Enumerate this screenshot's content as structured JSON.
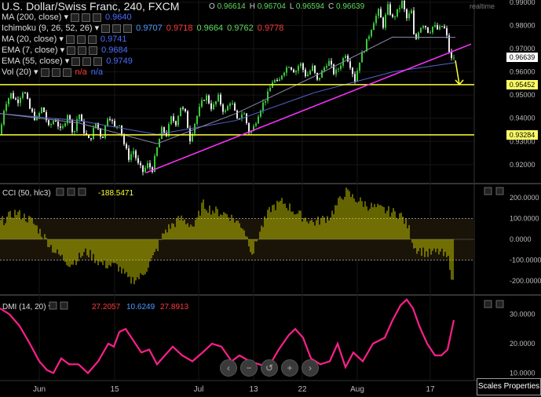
{
  "header": {
    "title": "U.S. Dollar/Swiss Franc, 240, FXCM",
    "ohlc": [
      {
        "k": "O",
        "v": "0.96614"
      },
      {
        "k": "H",
        "v": "0.96704"
      },
      {
        "k": "L",
        "v": "0.96594"
      },
      {
        "k": "C",
        "v": "0.96639"
      }
    ],
    "realtime": "realtime"
  },
  "indicators": [
    {
      "label": "MA (200, close)",
      "values": [
        {
          "v": "0.9640",
          "color": "#4a6cff"
        }
      ]
    },
    {
      "label": "Ichimoku (9, 26, 52, 26)",
      "values": [
        {
          "v": "0.9707",
          "color": "#4a9cff"
        },
        {
          "v": "0.9718",
          "color": "#ff3b3b"
        },
        {
          "v": "0.9664",
          "color": "#5fdc5f"
        },
        {
          "v": "0.9762",
          "color": "#5fdc5f"
        },
        {
          "v": "0.9778",
          "color": "#ff3b3b"
        }
      ]
    },
    {
      "label": "MA (20, close)",
      "values": [
        {
          "v": "0.9741",
          "color": "#4a6cff"
        }
      ]
    },
    {
      "label": "EMA (7, close)",
      "values": [
        {
          "v": "0.9684",
          "color": "#4a6cff"
        }
      ]
    },
    {
      "label": "EMA (55, close)",
      "values": [
        {
          "v": "0.9749",
          "color": "#4a6cff"
        }
      ]
    },
    {
      "label": "Vol (20)",
      "values": [
        {
          "v": "n/a",
          "color": "#ff3b3b"
        },
        {
          "v": "n/a",
          "color": "#4a6cff"
        }
      ]
    }
  ],
  "price_boxes": [
    {
      "v": "0.96639",
      "bg": "#ffffff"
    },
    {
      "v": "0.95452",
      "bg": "#ffff66"
    },
    {
      "v": "0.93284",
      "bg": "#ffff66"
    }
  ],
  "controls": {
    "scales_properties": "Scales Properties",
    "zoom_buttons": [
      "‹",
      "−",
      "↺",
      "+",
      "›"
    ]
  },
  "chart_data": [
    {
      "type": "candlestick",
      "title": "U.S. Dollar/Swiss Franc, 240, FXCM",
      "x_ticks": [
        "Jun",
        "15",
        "Jul",
        "13",
        "22",
        "Aug",
        "17"
      ],
      "y_ticks": [
        "0.99000",
        "0.98000",
        "0.97000",
        "0.96000",
        "0.95000",
        "0.94000",
        "0.93000",
        "0.92000"
      ],
      "ylim": [
        0.9125,
        0.991
      ],
      "close_path": [
        [
          0,
          0.933
        ],
        [
          6,
          0.946
        ],
        [
          14,
          0.9505
        ],
        [
          22,
          0.947
        ],
        [
          30,
          0.9525
        ],
        [
          38,
          0.944
        ],
        [
          46,
          0.939
        ],
        [
          54,
          0.945
        ],
        [
          62,
          0.936
        ],
        [
          70,
          0.94
        ],
        [
          78,
          0.934
        ],
        [
          86,
          0.942
        ],
        [
          94,
          0.933
        ],
        [
          100,
          0.943
        ],
        [
          106,
          0.935
        ],
        [
          114,
          0.93
        ],
        [
          122,
          0.938
        ],
        [
          130,
          0.931
        ],
        [
          138,
          0.942
        ],
        [
          146,
          0.936
        ],
        [
          152,
          0.938
        ],
        [
          158,
          0.929
        ],
        [
          164,
          0.923
        ],
        [
          170,
          0.926
        ],
        [
          176,
          0.92
        ],
        [
          182,
          0.917
        ],
        [
          188,
          0.92
        ],
        [
          194,
          0.918
        ],
        [
          200,
          0.927
        ],
        [
          206,
          0.935
        ],
        [
          212,
          0.933
        ],
        [
          218,
          0.94
        ],
        [
          224,
          0.938
        ],
        [
          230,
          0.945
        ],
        [
          236,
          0.942
        ],
        [
          242,
          0.931
        ],
        [
          248,
          0.938
        ],
        [
          256,
          0.946
        ],
        [
          262,
          0.95
        ],
        [
          270,
          0.944
        ],
        [
          278,
          0.949
        ],
        [
          286,
          0.942
        ],
        [
          294,
          0.948
        ],
        [
          302,
          0.939
        ],
        [
          310,
          0.943
        ],
        [
          318,
          0.933
        ],
        [
          324,
          0.937
        ],
        [
          330,
          0.943
        ],
        [
          336,
          0.947
        ],
        [
          342,
          0.951
        ],
        [
          348,
          0.957
        ],
        [
          354,
          0.9545
        ],
        [
          360,
          0.96
        ],
        [
          368,
          0.963
        ],
        [
          376,
          0.96
        ],
        [
          382,
          0.964
        ],
        [
          390,
          0.958
        ],
        [
          398,
          0.962
        ],
        [
          404,
          0.956
        ],
        [
          410,
          0.96
        ],
        [
          418,
          0.965
        ],
        [
          426,
          0.959
        ],
        [
          432,
          0.962
        ],
        [
          440,
          0.968
        ],
        [
          446,
          0.963
        ],
        [
          452,
          0.9565
        ],
        [
          458,
          0.965
        ],
        [
          464,
          0.97
        ],
        [
          470,
          0.976
        ],
        [
          476,
          0.982
        ],
        [
          482,
          0.986
        ],
        [
          488,
          0.98
        ],
        [
          494,
          0.988
        ],
        [
          500,
          0.983
        ],
        [
          506,
          0.986
        ],
        [
          512,
          0.99
        ],
        [
          518,
          0.983
        ],
        [
          524,
          0.986
        ],
        [
          528,
          0.972
        ],
        [
          534,
          0.979
        ],
        [
          540,
          0.981
        ],
        [
          546,
          0.977
        ],
        [
          552,
          0.98
        ],
        [
          558,
          0.978
        ],
        [
          564,
          0.98
        ],
        [
          568,
          0.977
        ],
        [
          574,
          0.965
        ],
        [
          578,
          0.9664
        ]
      ],
      "horizontal_levels": [
        0.95452,
        0.93284
      ],
      "trendline": [
        [
          186,
          0.9165
        ],
        [
          600,
          0.972
        ]
      ],
      "arrow": {
        "from": [
          580,
          0.965
        ],
        "to": [
          585,
          0.9545
        ]
      },
      "ma_lines": [
        {
          "name": "MA (200, close)",
          "color": "#5566cc",
          "points": [
            [
              0,
              0.942
            ],
            [
              100,
              0.939
            ],
            [
              200,
              0.933
            ],
            [
              300,
              0.939
            ],
            [
              400,
              0.951
            ],
            [
              500,
              0.96
            ],
            [
              580,
              0.964
            ]
          ]
        },
        {
          "name": "EMA (55, close)",
          "color": "#8888aa",
          "points": [
            [
              0,
              0.942
            ],
            [
              100,
              0.938
            ],
            [
              200,
              0.929
            ],
            [
              300,
              0.942
            ],
            [
              400,
              0.958
            ],
            [
              500,
              0.975
            ],
            [
              580,
              0.9749
            ]
          ]
        }
      ]
    },
    {
      "type": "bar",
      "title": "CCI (50, hlc3)",
      "value_label": "-188.5471",
      "y_ticks": [
        "200.0000",
        "100.0000",
        "0.0000",
        "-100.0000",
        "-200.0000"
      ],
      "ylim": [
        -260,
        260
      ],
      "reference_lines": [
        100,
        -100
      ],
      "profile": [
        [
          0,
          80
        ],
        [
          20,
          130
        ],
        [
          40,
          90
        ],
        [
          55,
          20
        ],
        [
          70,
          -60
        ],
        [
          90,
          -120
        ],
        [
          110,
          -60
        ],
        [
          130,
          -120
        ],
        [
          150,
          -130
        ],
        [
          165,
          -200
        ],
        [
          180,
          -180
        ],
        [
          195,
          -90
        ],
        [
          210,
          40
        ],
        [
          230,
          100
        ],
        [
          248,
          60
        ],
        [
          258,
          170
        ],
        [
          270,
          140
        ],
        [
          290,
          120
        ],
        [
          310,
          60
        ],
        [
          322,
          -70
        ],
        [
          330,
          30
        ],
        [
          345,
          150
        ],
        [
          360,
          180
        ],
        [
          380,
          120
        ],
        [
          400,
          80
        ],
        [
          420,
          110
        ],
        [
          440,
          230
        ],
        [
          450,
          200
        ],
        [
          470,
          160
        ],
        [
          490,
          140
        ],
        [
          510,
          120
        ],
        [
          520,
          60
        ],
        [
          528,
          -40
        ],
        [
          545,
          -70
        ],
        [
          560,
          -60
        ],
        [
          572,
          -100
        ],
        [
          578,
          -240
        ]
      ]
    },
    {
      "type": "line",
      "title": "DMI (14, 20)",
      "values": [
        "27.2057",
        "10.6249",
        "27.8913"
      ],
      "y_ticks": [
        "30.0000",
        "20.0000",
        "10.0000"
      ],
      "ylim": [
        8,
        36
      ],
      "points": [
        [
          0,
          32
        ],
        [
          12,
          30
        ],
        [
          25,
          26
        ],
        [
          38,
          20
        ],
        [
          50,
          14
        ],
        [
          60,
          11
        ],
        [
          68,
          10
        ],
        [
          78,
          15
        ],
        [
          88,
          13
        ],
        [
          100,
          13
        ],
        [
          112,
          10
        ],
        [
          125,
          14
        ],
        [
          138,
          20
        ],
        [
          145,
          19
        ],
        [
          152,
          24
        ],
        [
          160,
          25
        ],
        [
          170,
          21
        ],
        [
          180,
          17
        ],
        [
          190,
          18
        ],
        [
          200,
          13
        ],
        [
          210,
          16
        ],
        [
          220,
          19
        ],
        [
          232,
          16
        ],
        [
          245,
          14
        ],
        [
          258,
          17
        ],
        [
          270,
          20
        ],
        [
          282,
          19
        ],
        [
          295,
          14
        ],
        [
          305,
          16
        ],
        [
          318,
          14
        ],
        [
          330,
          13
        ],
        [
          342,
          12
        ],
        [
          355,
          18
        ],
        [
          368,
          23
        ],
        [
          376,
          25
        ],
        [
          386,
          22
        ],
        [
          396,
          15
        ],
        [
          408,
          13
        ],
        [
          420,
          14
        ],
        [
          430,
          20
        ],
        [
          440,
          12
        ],
        [
          450,
          17
        ],
        [
          462,
          14
        ],
        [
          475,
          20
        ],
        [
          490,
          22
        ],
        [
          500,
          28
        ],
        [
          510,
          33
        ],
        [
          518,
          35
        ],
        [
          526,
          32
        ],
        [
          534,
          26
        ],
        [
          544,
          20
        ],
        [
          554,
          16
        ],
        [
          562,
          16
        ],
        [
          570,
          18
        ],
        [
          578,
          28
        ]
      ]
    }
  ]
}
